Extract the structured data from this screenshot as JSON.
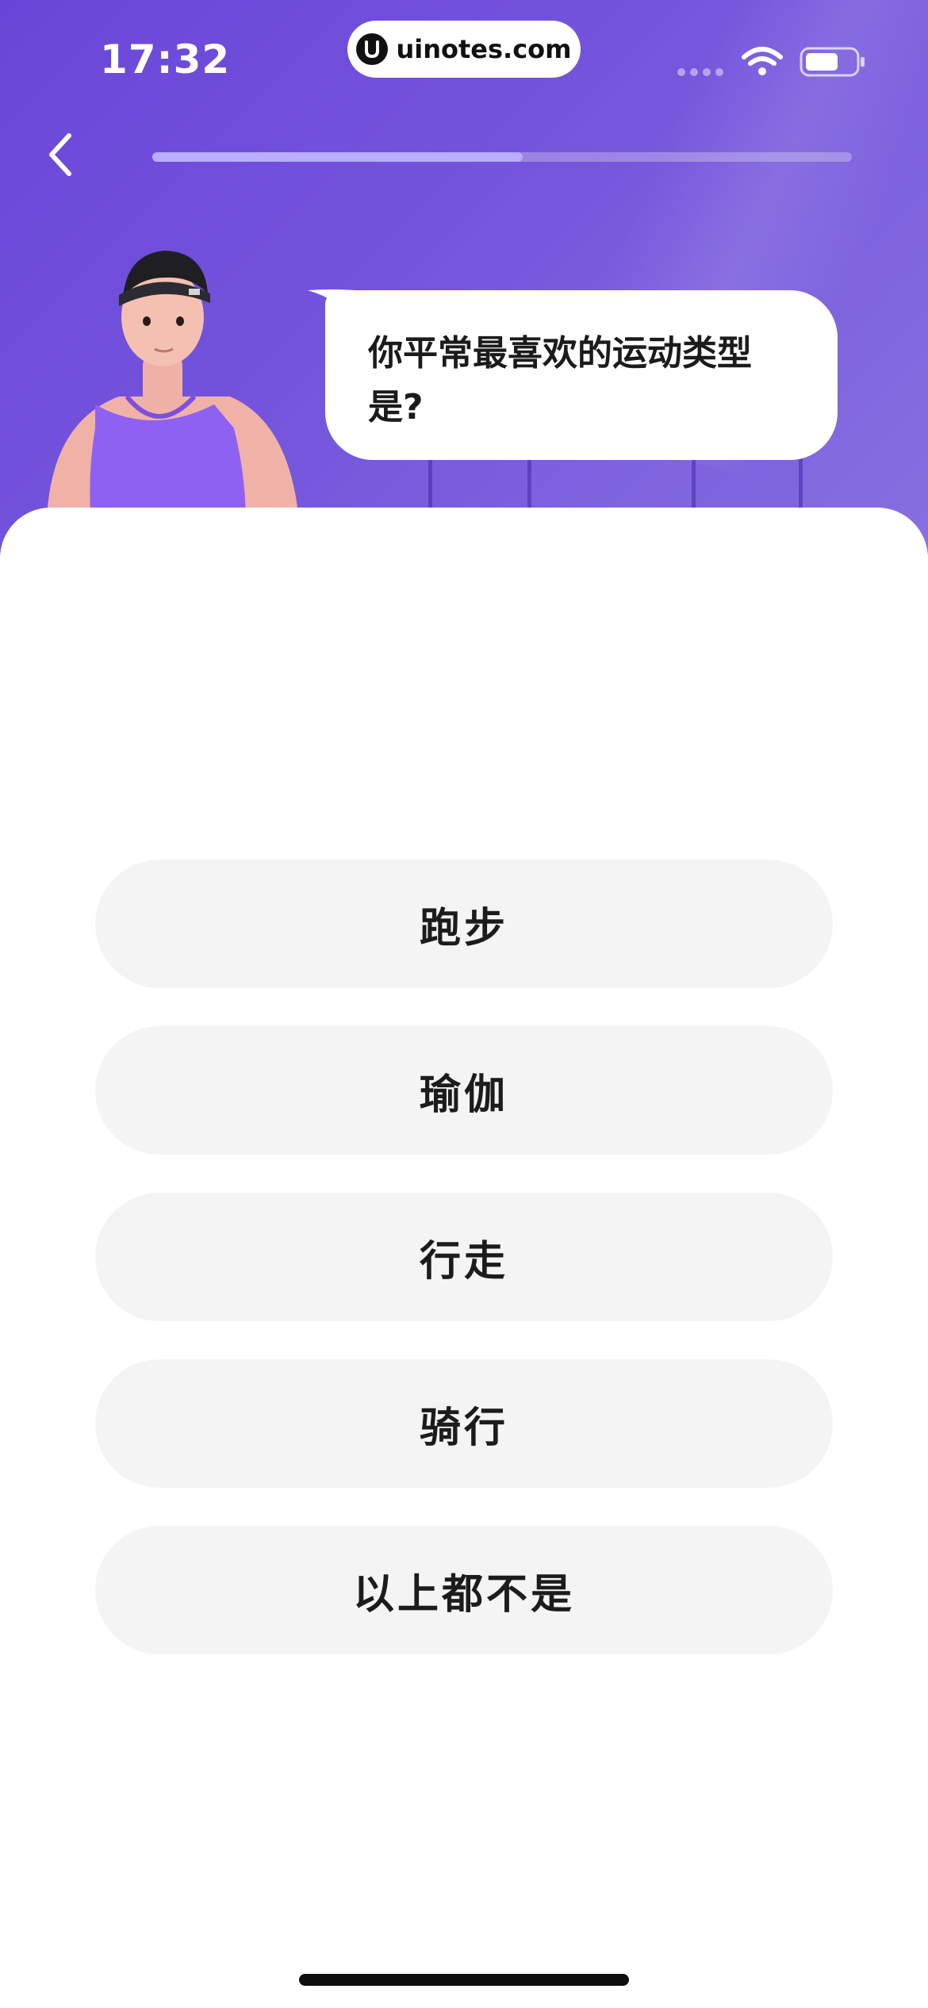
{
  "status_bar": {
    "time": "17:32",
    "watermark_url": "uinotes.com"
  },
  "nav": {
    "back_icon": "chevron-left-icon",
    "progress": 0.53
  },
  "question": {
    "text": "你平常最喜欢的运动类型是?"
  },
  "options": [
    {
      "label": "跑步"
    },
    {
      "label": "瑜伽"
    },
    {
      "label": "行走"
    },
    {
      "label": "骑行"
    },
    {
      "label": "以上都不是"
    }
  ],
  "colors": {
    "hero_purple": "#7454dc",
    "progress_fill": "#b9adff",
    "option_bg": "#f4f4f4"
  }
}
